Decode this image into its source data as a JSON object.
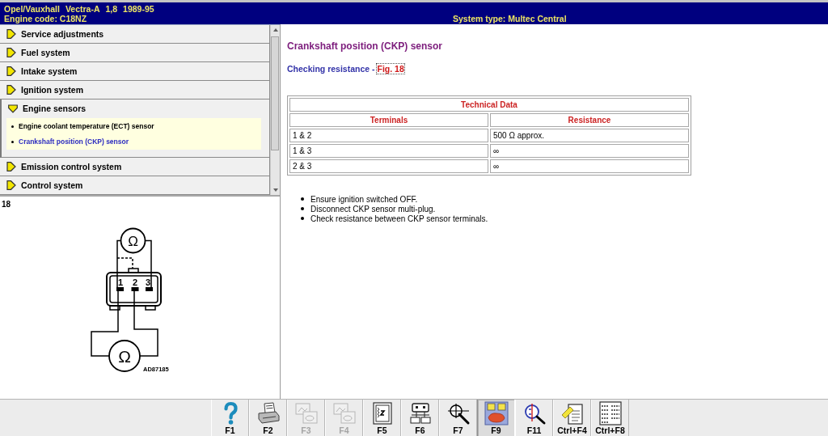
{
  "header": {
    "vehicle": [
      "Opel/Vauxhall",
      "Vectra-A",
      "1,8",
      "1989-95"
    ],
    "engine_code": "Engine code: C18NZ",
    "system_type": "System type: Multec Central"
  },
  "menu": {
    "items": [
      {
        "label": "Service adjustments",
        "expanded": false
      },
      {
        "label": "Fuel system",
        "expanded": false
      },
      {
        "label": "Intake system",
        "expanded": false
      },
      {
        "label": "Ignition system",
        "expanded": false
      },
      {
        "label": "Engine sensors",
        "expanded": true,
        "children": [
          {
            "label": "Engine coolant temperature (ECT) sensor",
            "selected": false
          },
          {
            "label": "Crankshaft position (CKP) sensor",
            "selected": true
          }
        ]
      },
      {
        "label": "Emission control system",
        "expanded": false
      },
      {
        "label": "Control system",
        "expanded": false
      }
    ]
  },
  "figure": {
    "number": "18",
    "meters": [
      "Ω",
      "Ω"
    ],
    "pins": [
      "1",
      "2",
      "3"
    ],
    "code": "AD87185"
  },
  "content": {
    "title": "Crankshaft position (CKP) sensor",
    "subtitle": "Checking resistance -",
    "link": "Fig. 18",
    "table": {
      "caption": "Technical Data",
      "columns": [
        "Terminals",
        "Resistance"
      ],
      "rows": [
        [
          "1 & 2",
          "500 Ω approx."
        ],
        [
          "1 & 3",
          "∞"
        ],
        [
          "2 & 3",
          "∞"
        ]
      ]
    },
    "steps": [
      "Ensure ignition switched OFF.",
      "Disconnect CKP sensor multi-plug.",
      "Check resistance between CKP sensor terminals."
    ]
  },
  "toolbar": [
    {
      "kind": "help",
      "label": "F1",
      "disabled": false,
      "selected": false
    },
    {
      "kind": "printer",
      "label": "F2",
      "disabled": false,
      "selected": false
    },
    {
      "kind": "pictures",
      "label": "F3",
      "disabled": true,
      "selected": false
    },
    {
      "kind": "pictures",
      "label": "F4",
      "disabled": true,
      "selected": false
    },
    {
      "kind": "document",
      "label": "F5",
      "disabled": false,
      "selected": false
    },
    {
      "kind": "connector",
      "label": "F6",
      "disabled": false,
      "selected": false
    },
    {
      "kind": "probe",
      "label": "F7",
      "disabled": false,
      "selected": false
    },
    {
      "kind": "wiring",
      "label": "F9",
      "disabled": false,
      "selected": true
    },
    {
      "kind": "scope",
      "label": "F11",
      "disabled": false,
      "selected": false
    },
    {
      "kind": "notes",
      "label": "Ctrl+F4",
      "disabled": false,
      "selected": false
    },
    {
      "kind": "table",
      "label": "Ctrl+F8",
      "disabled": false,
      "selected": false
    }
  ]
}
